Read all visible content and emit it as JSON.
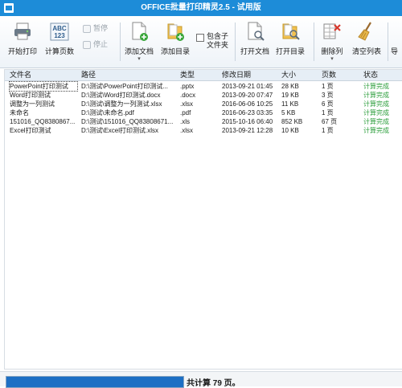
{
  "window": {
    "title": "OFFICE批量打印精灵2.5 - 试用版"
  },
  "toolbar": {
    "start_print": "开始打印",
    "count_pages": "计算页数",
    "pause": "暂停",
    "stop": "停止",
    "add_doc": "添加文档",
    "add_dir": "添加目录",
    "include_sub": "包含子文件夹",
    "open_doc": "打开文档",
    "open_dir": "打开目录",
    "delete_col": "删除列",
    "clear_list": "清空列表",
    "export_partial": "导",
    "dropdown_arrow": "▾"
  },
  "table": {
    "columns": [
      "文件名",
      "路径",
      "类型",
      "修改日期",
      "大小",
      "页数",
      "状态"
    ],
    "rows": [
      [
        "PowerPoint打印测试",
        "D:\\测试\\PowerPoint打印测试...",
        ".pptx",
        "2013-09-21 01:45",
        "28 KB",
        "1 页",
        "计算完成"
      ],
      [
        "Word打印测试",
        "D:\\测试\\Word打印测试.docx",
        ".docx",
        "2013-09-20 07:47",
        "19 KB",
        "3 页",
        "计算完成"
      ],
      [
        "调整为一列测试",
        "D:\\测试\\调整为一列测试.xlsx",
        ".xlsx",
        "2016-06-06 10:25",
        "11 KB",
        "6 页",
        "计算完成"
      ],
      [
        "未命名",
        "D:\\测试\\未命名.pdf",
        ".pdf",
        "2016-06-23 03:35",
        "5 KB",
        "1 页",
        "计算完成"
      ],
      [
        "151016_QQ8380867...",
        "D:\\测试\\151016_QQ83808671...",
        ".xls",
        "2015-10-16 06:40",
        "852 KB",
        "67 页",
        "计算完成"
      ],
      [
        "Excel打印测试",
        "D:\\测试\\Excel打印测试.xlsx",
        ".xlsx",
        "2013-09-21 12:28",
        "10 KB",
        "1 页",
        "计算完成"
      ]
    ]
  },
  "footer": {
    "total_text": "共计算 79 页。",
    "progress": 1.0
  },
  "colors": {
    "accent": "#1d8cd8",
    "status_ok": "#2a9d3a",
    "progress": "#1d6fc4"
  }
}
